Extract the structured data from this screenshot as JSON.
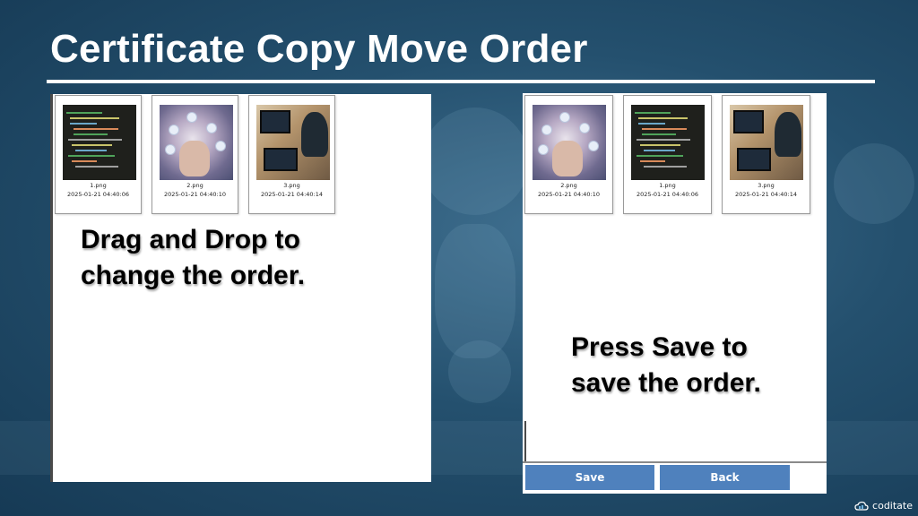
{
  "page": {
    "title": "Certificate Copy Move Order",
    "brand": "coditate"
  },
  "left_panel": {
    "instruction_line1": "Drag and Drop to",
    "instruction_line2": "change the order.",
    "cards": [
      {
        "name": "1.png",
        "date": "2025-01-21 04:40:06",
        "image": "code-image"
      },
      {
        "name": "2.png",
        "date": "2025-01-21 04:40:10",
        "image": "hand-network-image"
      },
      {
        "name": "3.png",
        "date": "2025-01-21 04:40:14",
        "image": "desk-computer-image"
      }
    ]
  },
  "right_panel": {
    "instruction_line1": "Press Save to",
    "instruction_line2": "save the order.",
    "cards": [
      {
        "name": "2.png",
        "date": "2025-01-21 04:40:10",
        "image": "hand-network-image"
      },
      {
        "name": "1.png",
        "date": "2025-01-21 04:40:06",
        "image": "code-image"
      },
      {
        "name": "3.png",
        "date": "2025-01-21 04:40:14",
        "image": "desk-computer-image"
      }
    ],
    "save_label": "Save",
    "back_label": "Back"
  },
  "colors": {
    "button": "#4f81bd",
    "background": "#24506e"
  }
}
